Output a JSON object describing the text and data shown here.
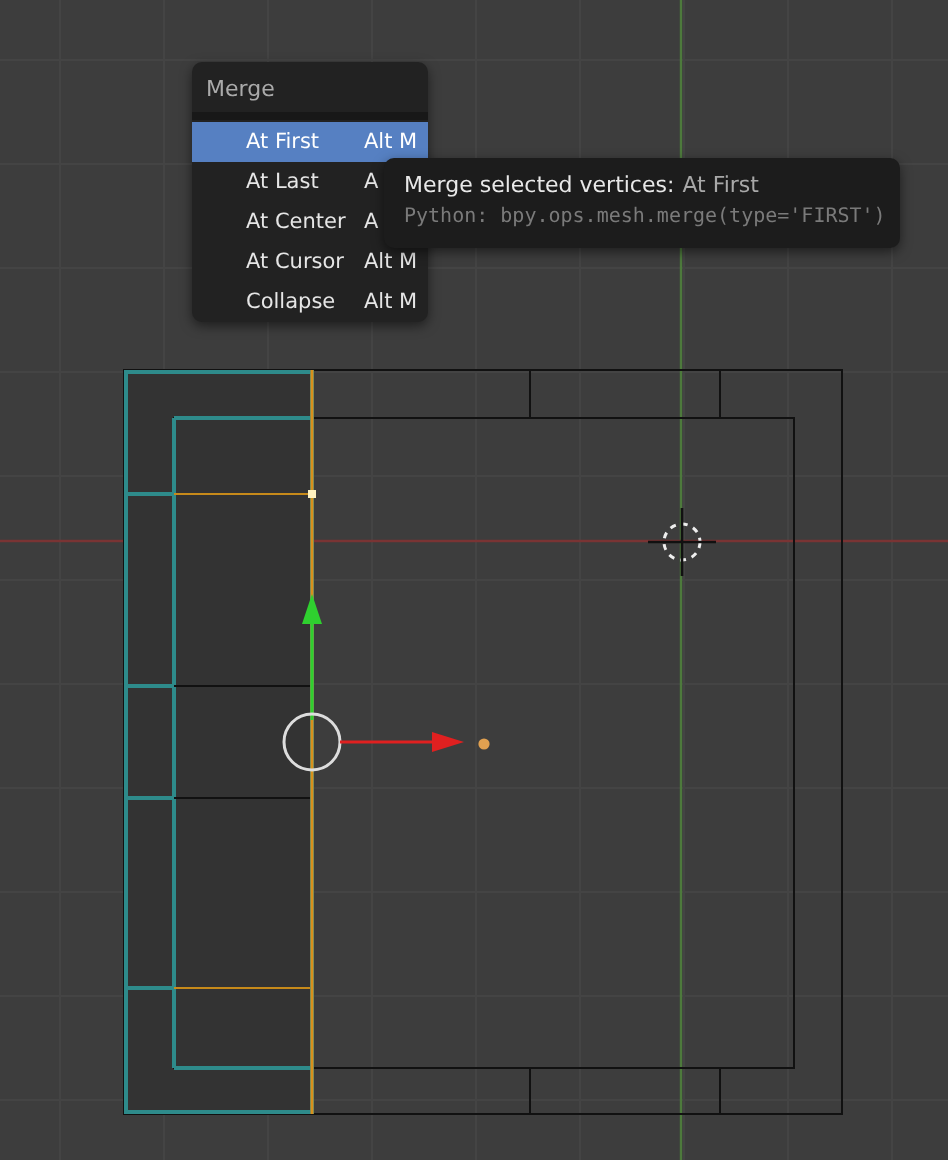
{
  "menu": {
    "title": "Merge",
    "items": [
      {
        "label": "At First",
        "shortcut": "Alt M",
        "selected": true
      },
      {
        "label": "At Last",
        "shortcut": "A",
        "selected": false
      },
      {
        "label": "At Center",
        "shortcut": "A",
        "selected": false
      },
      {
        "label": "At Cursor",
        "shortcut": "Alt M",
        "selected": false
      },
      {
        "label": "Collapse",
        "shortcut": "Alt M",
        "selected": false
      }
    ]
  },
  "tooltip": {
    "title": "Merge selected vertices:",
    "value": "At First",
    "python": "Python: bpy.ops.mesh.merge(type='FIRST')"
  }
}
